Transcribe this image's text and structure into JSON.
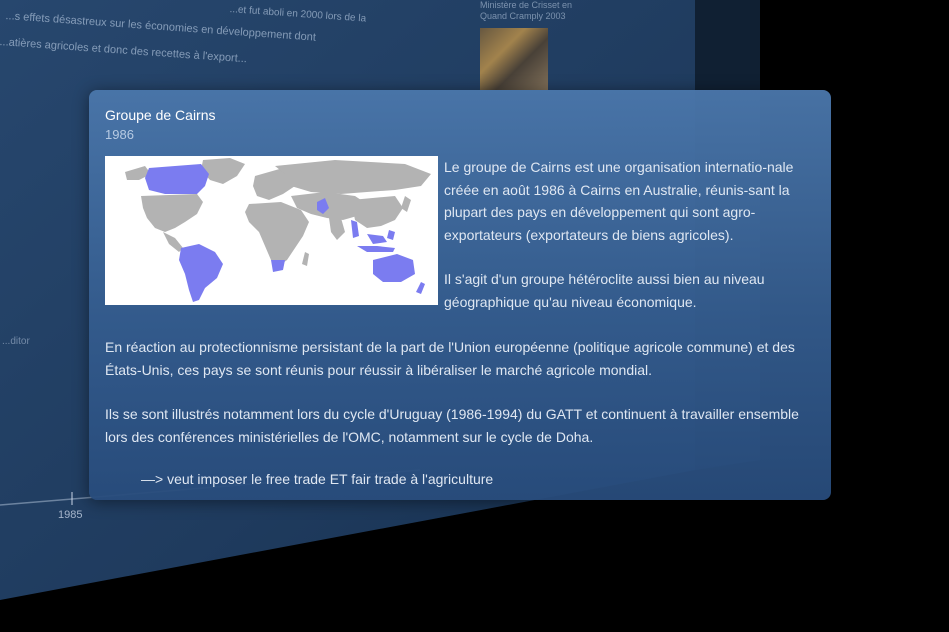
{
  "background": {
    "text_line1": "...s effets désastreux sur les économies en développement dont",
    "text_line2": "...atières agricoles et donc des recettes à l'export...",
    "text_line3": "...et fut aboli en 2000 lors de la",
    "photo_title": "Ministère de Crisset en Quand Cramply 2003",
    "photo_caption": "",
    "left_label": "...ditor",
    "axis_year": "1985"
  },
  "card": {
    "title": "Groupe de Cairns",
    "year": "1986",
    "map_icon": "world-map",
    "map_colors": {
      "member": "#7b7cf0",
      "other": "#b3b3b3",
      "background": "#ffffff"
    },
    "side_paragraphs": [
      "Le groupe de Cairns est une organisation internatio-nale créée en août 1986 à Cairns en Australie, réunis-sant la plupart des pays en développement qui sont agro-exportateurs (exportateurs de biens agricoles).",
      "Il s'agit d'un groupe hétéroclite aussi bien au niveau géographique qu'au niveau économique."
    ],
    "body_paragraphs": [
      "En réaction au protectionnisme persistant de la part de l'Union européenne (politique agricole commune) et des États-Unis, ces pays se sont réunis pour réussir à libéraliser le marché agricole mondial.",
      "Ils se sont illustrés notamment lors du cycle d'Uruguay (1986-1994) du GATT et continuent à travailler ensemble lors des conférences ministérielles de l'OMC, notamment sur le cycle de Doha."
    ],
    "note": "—> veut imposer le free trade ET fair trade à l'agriculture"
  }
}
